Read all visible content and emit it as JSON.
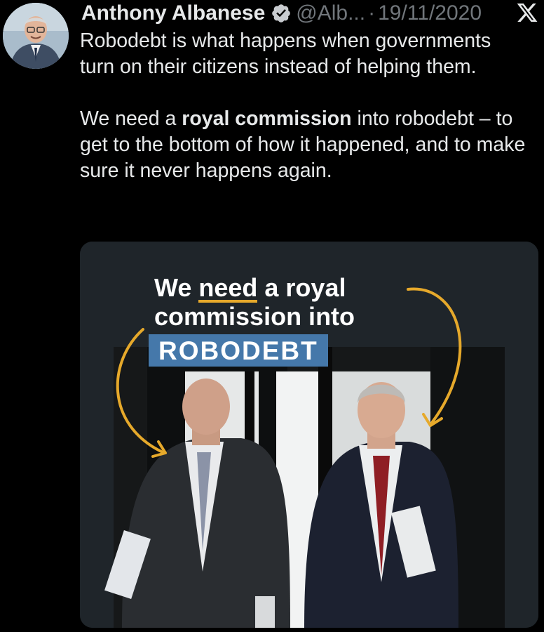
{
  "tweet": {
    "display_name": "Anthony Albanese",
    "handle": "@Alb...",
    "separator": "·",
    "date": "19/11/2020",
    "paragraph1": "Robodebt is what happens when governments turn on their citizens instead of helping them.",
    "paragraph2_before": "We need a ",
    "paragraph2_bold": "royal commission",
    "paragraph2_after": " into robodebt – to get to the bottom of how it happened, and to make sure it never happens again."
  },
  "media": {
    "headline_part1": "We ",
    "headline_underlined": "need",
    "headline_part2": " a royal",
    "headline_line2": "commission into",
    "highlight": "ROBODEBT"
  },
  "icons": {
    "verified": "verified-badge-icon",
    "platform": "x-logo-icon"
  },
  "colors": {
    "background": "#000000",
    "text": "#e7e9ea",
    "muted": "#71767b",
    "accent_arrow": "#e6a92b",
    "highlight_box": "#4578aa"
  }
}
